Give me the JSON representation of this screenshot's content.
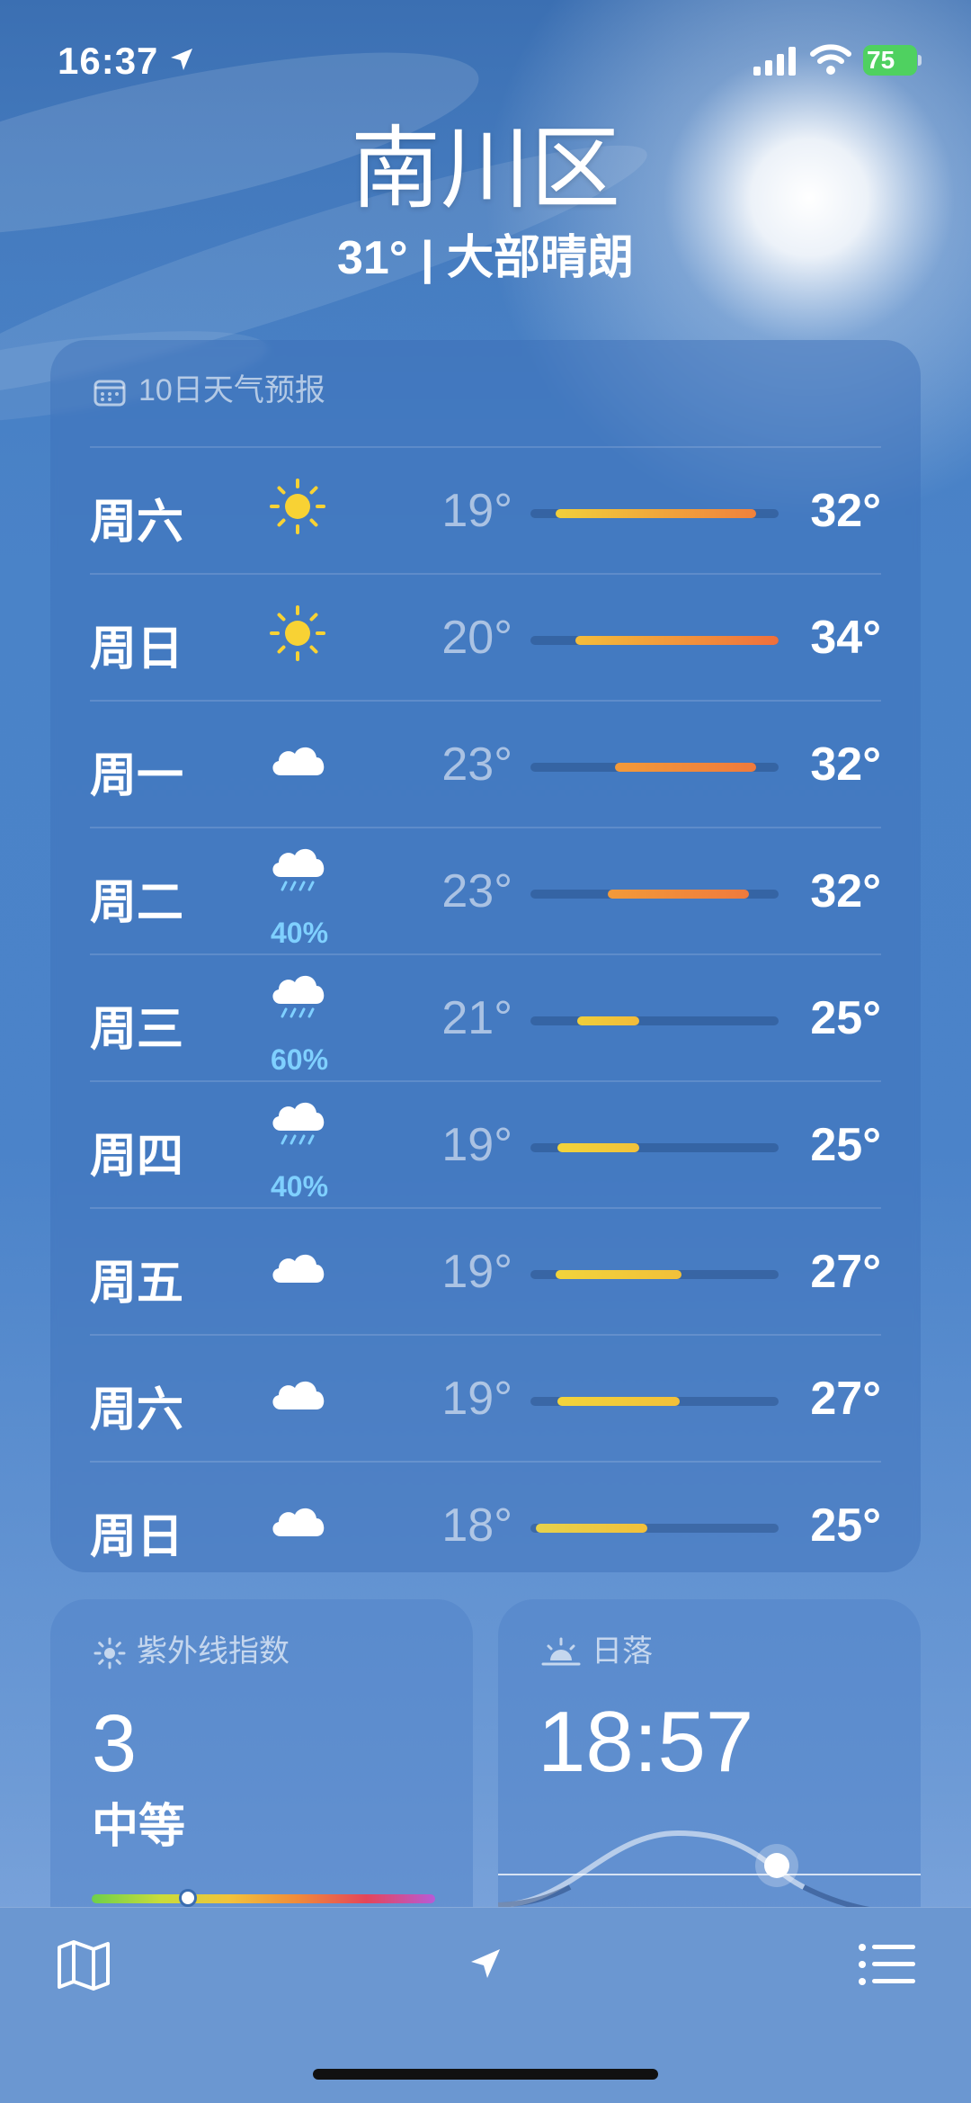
{
  "status_bar": {
    "time": "16:37",
    "battery": "75"
  },
  "header": {
    "city": "南川区",
    "summary": "31° | 大部晴朗"
  },
  "forecast": {
    "title": "10日天气预报",
    "days": [
      {
        "day": "周六",
        "icon": "sun-icon",
        "precip": "",
        "low": "19°",
        "high": "32°",
        "range_start": 0.1,
        "range_end": 0.91,
        "color_from": "#f2cf3a",
        "color_to": "#f0813c"
      },
      {
        "day": "周日",
        "icon": "sun-icon",
        "precip": "",
        "low": "20°",
        "high": "34°",
        "range_start": 0.18,
        "range_end": 1.0,
        "color_from": "#f4bd3a",
        "color_to": "#ef6f3c"
      },
      {
        "day": "周一",
        "icon": "cloud-icon",
        "precip": "",
        "low": "23°",
        "high": "32°",
        "range_start": 0.34,
        "range_end": 0.91,
        "color_from": "#f29a3a",
        "color_to": "#ef7a3c"
      },
      {
        "day": "周二",
        "icon": "rain-icon",
        "precip": "40%",
        "low": "23°",
        "high": "32°",
        "range_start": 0.31,
        "range_end": 0.88,
        "color_from": "#f29a3a",
        "color_to": "#ef7a3c"
      },
      {
        "day": "周三",
        "icon": "rain-icon",
        "precip": "60%",
        "low": "21°",
        "high": "25°",
        "range_start": 0.19,
        "range_end": 0.44,
        "color_from": "#f0cf3a",
        "color_to": "#f2bb3a"
      },
      {
        "day": "周四",
        "icon": "rain-icon",
        "precip": "40%",
        "low": "19°",
        "high": "25°",
        "range_start": 0.11,
        "range_end": 0.44,
        "color_from": "#f2d43b",
        "color_to": "#f2c23a"
      },
      {
        "day": "周五",
        "icon": "cloud-icon",
        "precip": "",
        "low": "19°",
        "high": "27°",
        "range_start": 0.1,
        "range_end": 0.61,
        "color_from": "#f2d43b",
        "color_to": "#f2c03a"
      },
      {
        "day": "周六",
        "icon": "cloud-icon",
        "precip": "",
        "low": "19°",
        "high": "27°",
        "range_start": 0.11,
        "range_end": 0.6,
        "color_from": "#f2d43b",
        "color_to": "#f2c03a"
      },
      {
        "day": "周日",
        "icon": "cloud-icon",
        "precip": "",
        "low": "18°",
        "high": "25°",
        "range_start": 0.02,
        "range_end": 0.47,
        "color_from": "#e7d24c",
        "color_to": "#f2c03a"
      }
    ]
  },
  "uv": {
    "title": "紫外线指数",
    "value": "3",
    "level": "中等",
    "fraction": 0.28
  },
  "sunset": {
    "title": "日落",
    "time": "18:57"
  },
  "colors": {
    "accent_precip": "#7fd0ff",
    "sky": "#4b83c9"
  }
}
